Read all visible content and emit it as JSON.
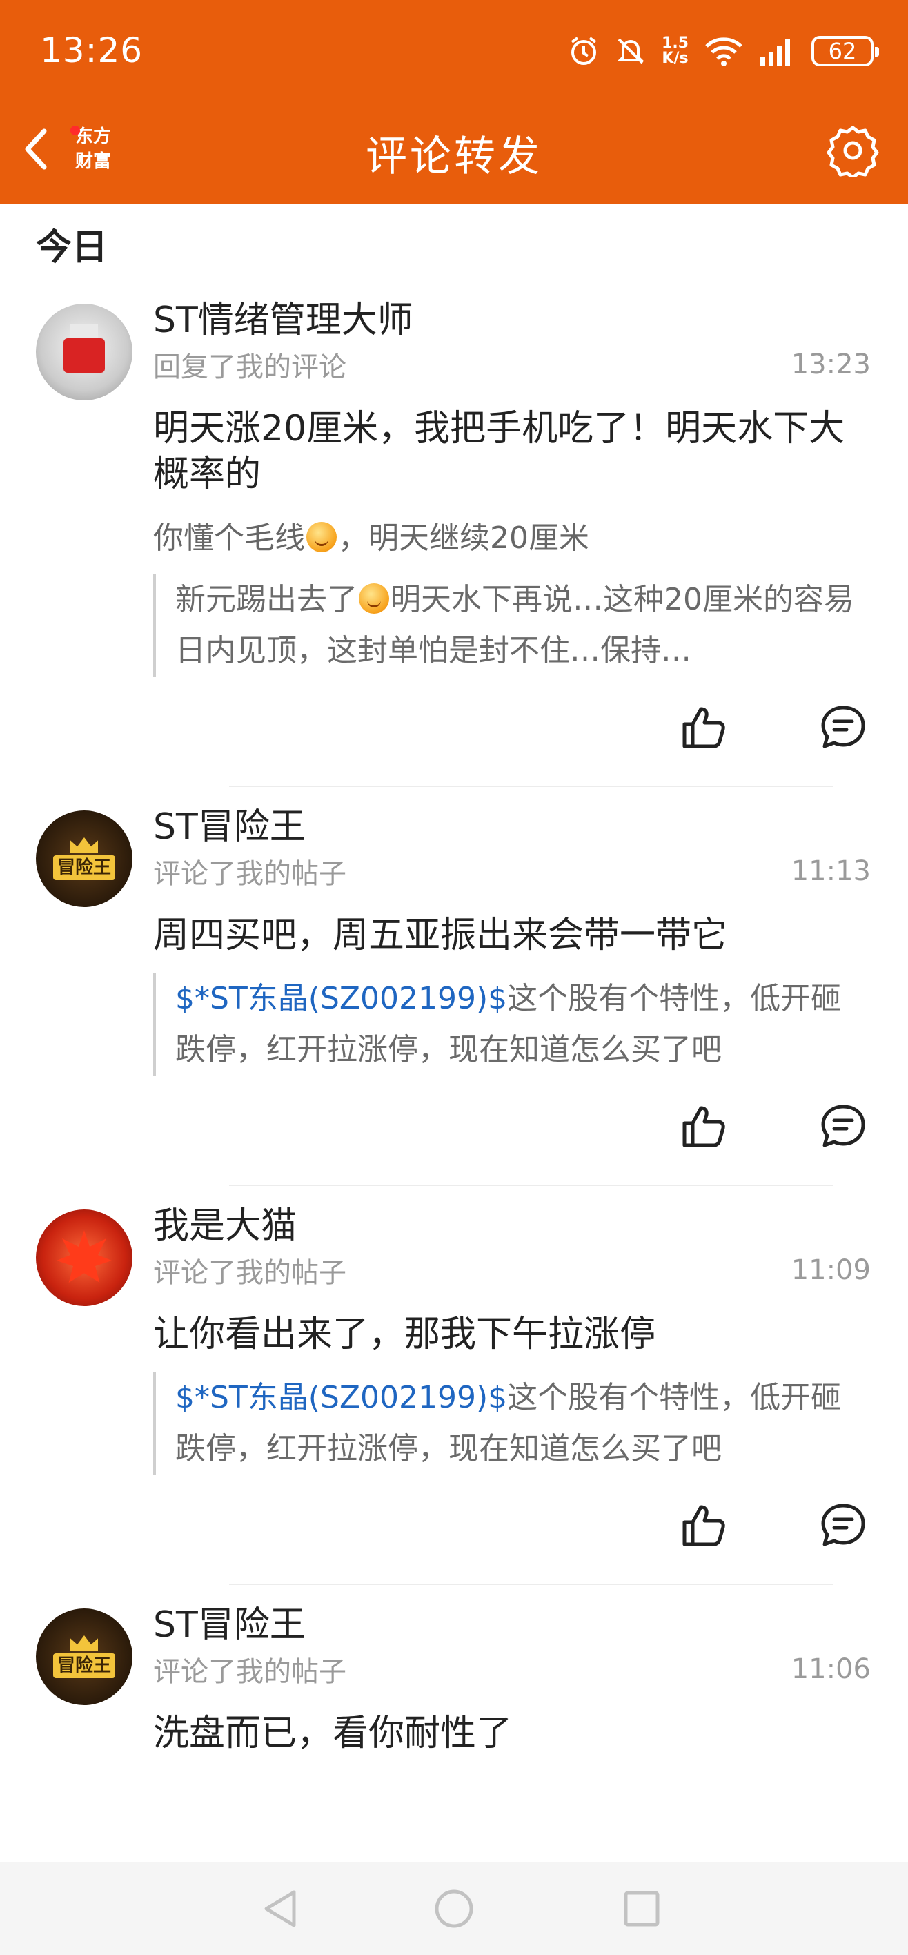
{
  "status_bar": {
    "time": "13:26",
    "net_speed_value": "1.5",
    "net_speed_unit": "K/s",
    "signal_label": "6",
    "battery": "62"
  },
  "header": {
    "logo_line1": "东方",
    "logo_line2": "财富",
    "title": "评论转发"
  },
  "section": {
    "title": "今日"
  },
  "items": [
    {
      "avatar": "bottle-avatar",
      "name": "ST情绪管理大师",
      "action": "回复了我的评论",
      "time": "13:23",
      "content": "明天涨20厘米，我把手机吃了！明天水下大概率的",
      "reply_part1": "你懂个毛线",
      "reply_part2": "，明天继续20厘米",
      "quote_part1": "新元踢出去了",
      "quote_part2": "明天水下再说…这种20厘米的容易日内见顶，这封单怕是封不住…保持…"
    },
    {
      "avatar": "king-avatar",
      "name": "ST冒险王",
      "action": "评论了我的帖子",
      "time": "11:13",
      "content": "周四买吧，周五亚振出来会带一带它",
      "quote_stock": "$*ST东晶(SZ002199)$",
      "quote_text": "这个股有个特性，低开砸跌停，红开拉涨停，现在知道怎么买了吧"
    },
    {
      "avatar": "maple-avatar",
      "name": "我是大猫",
      "action": "评论了我的帖子",
      "time": "11:09",
      "content": "让你看出来了，那我下午拉涨停",
      "quote_stock": "$*ST东晶(SZ002199)$",
      "quote_text": "这个股有个特性，低开砸跌停，红开拉涨停，现在知道怎么买了吧"
    },
    {
      "avatar": "king-avatar",
      "name": "ST冒险王",
      "action": "评论了我的帖子",
      "time": "11:06",
      "content": "洗盘而已，看你耐性了"
    }
  ],
  "avatar_text": {
    "king": "冒险王"
  },
  "colors": {
    "brand": "#e85d0c",
    "stock_link": "#1f66c1",
    "meta_text": "#9a9a9a"
  },
  "icons": [
    "back-icon",
    "settings-icon",
    "like-icon",
    "comment-icon",
    "nav-back-icon",
    "nav-home-icon",
    "nav-recents-icon"
  ]
}
